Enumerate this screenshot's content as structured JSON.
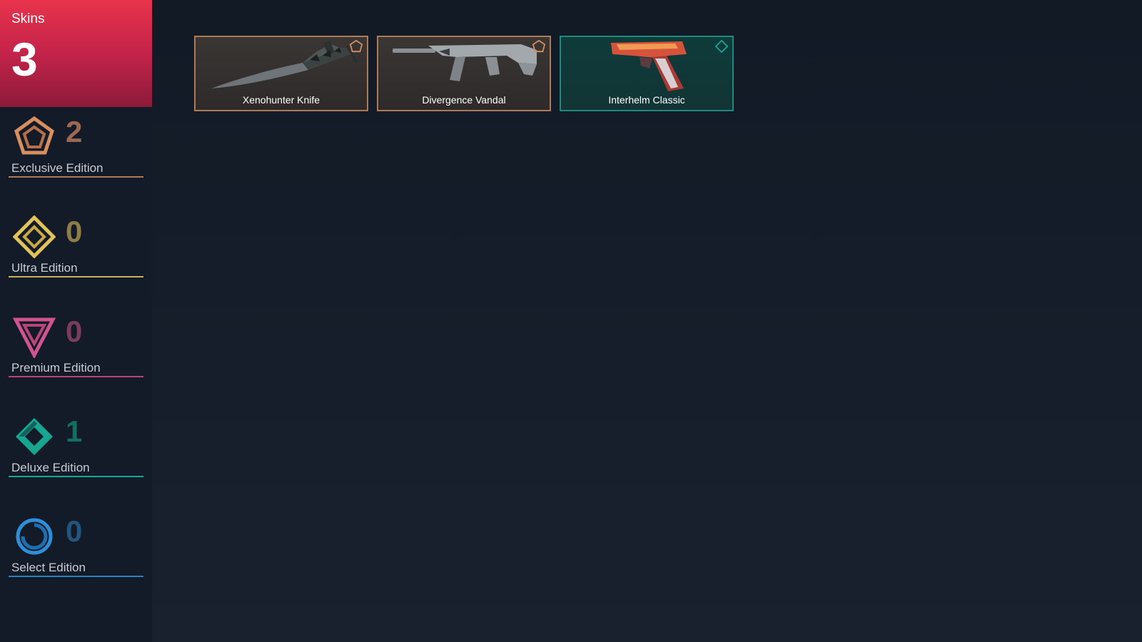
{
  "header": {
    "title": "Skins",
    "count": "3"
  },
  "tiers": [
    {
      "label": "Exclusive Edition",
      "count": "2",
      "icon": "exclusive-edition-icon",
      "color": "#d88f5f",
      "count_color": "#9a6a52"
    },
    {
      "label": "Ultra Edition",
      "count": "0",
      "icon": "ultra-edition-icon",
      "color": "#e2c35a",
      "count_color": "#8f7d49"
    },
    {
      "label": "Premium Edition",
      "count": "0",
      "icon": "premium-edition-icon",
      "color": "#d1538f",
      "count_color": "#7a3d5c"
    },
    {
      "label": "Deluxe Edition",
      "count": "1",
      "icon": "deluxe-edition-icon",
      "color": "#17a690",
      "count_color": "#146e64"
    },
    {
      "label": "Select Edition",
      "count": "0",
      "icon": "select-edition-icon",
      "color": "#2e8fd8",
      "count_color": "#23567e"
    }
  ],
  "cards": [
    {
      "name": "Xenohunter Knife",
      "tier": "exclusive",
      "tier_icon": "exclusive-edition-icon",
      "art": "knife-icon"
    },
    {
      "name": "Divergence Vandal",
      "tier": "exclusive",
      "tier_icon": "exclusive-edition-icon",
      "art": "rifle-icon"
    },
    {
      "name": "Interhelm Classic",
      "tier": "deluxe",
      "tier_icon": "deluxe-edition-icon",
      "art": "pistol-icon"
    }
  ]
}
